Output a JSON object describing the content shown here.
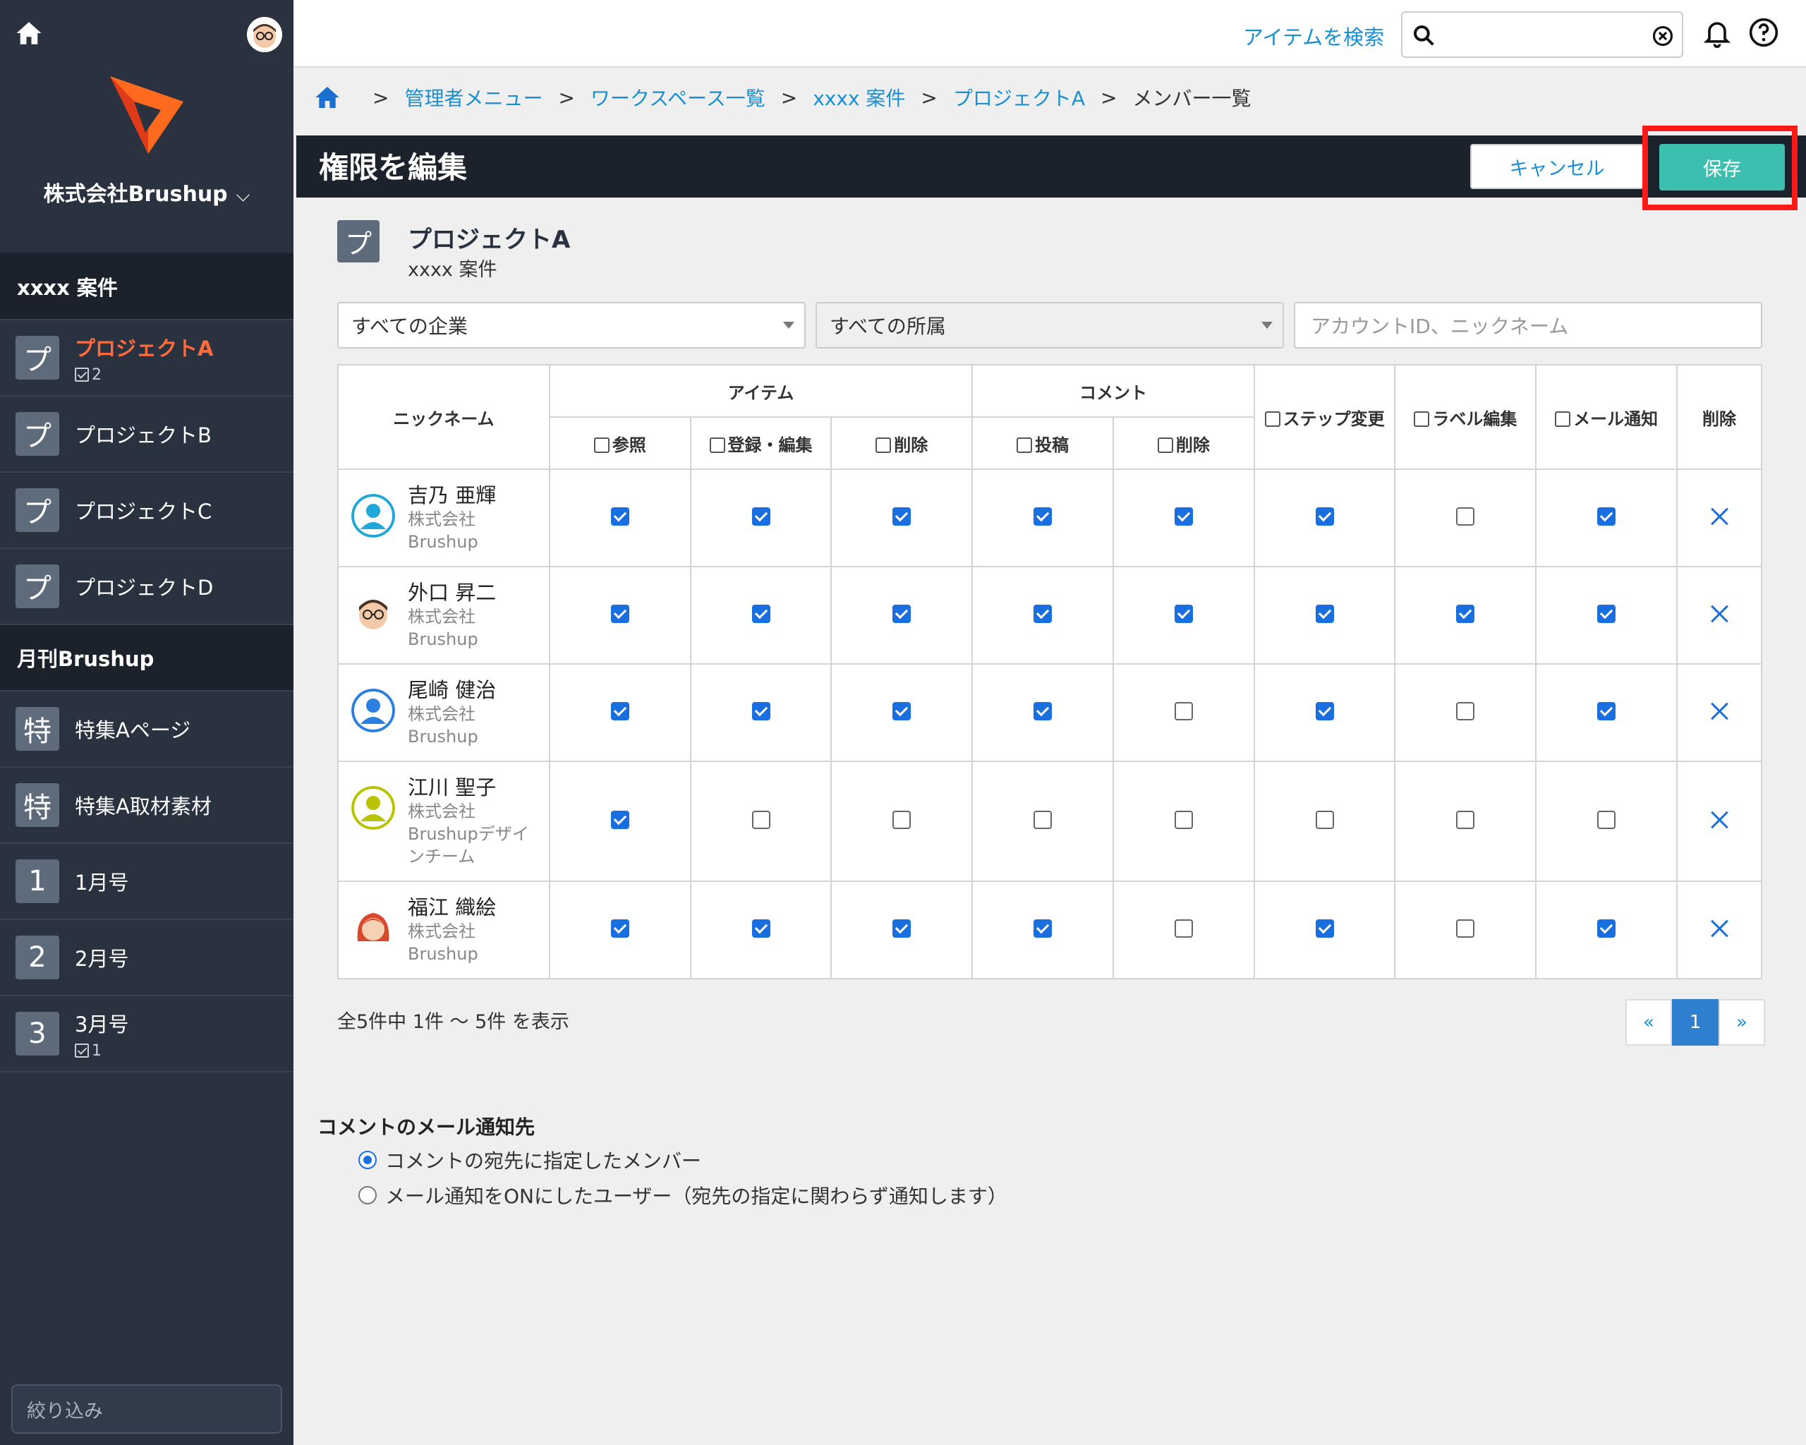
{
  "sidebar": {
    "company": "株式会社Brushup",
    "groups": [
      {
        "title": "xxxx 案件",
        "items": [
          {
            "badge": "プ",
            "label": "プロジェクトA",
            "count": "2",
            "active": true
          },
          {
            "badge": "プ",
            "label": "プロジェクトB"
          },
          {
            "badge": "プ",
            "label": "プロジェクトC"
          },
          {
            "badge": "プ",
            "label": "プロジェクトD"
          }
        ]
      },
      {
        "title": "月刊Brushup",
        "items": [
          {
            "badge": "特",
            "label": "特集Aページ"
          },
          {
            "badge": "特",
            "label": "特集A取材素材"
          },
          {
            "badge": "1",
            "label": "1月号"
          },
          {
            "badge": "2",
            "label": "2月号"
          },
          {
            "badge": "3",
            "label": "3月号",
            "count": "1"
          }
        ]
      }
    ],
    "filter_placeholder": "絞り込み"
  },
  "topbar": {
    "search_link": "アイテムを検索",
    "search_value": ""
  },
  "breadcrumb": {
    "items": [
      "管理者メニュー",
      "ワークスペース一覧",
      "xxxx 案件",
      "プロジェクトA"
    ],
    "current": "メンバー一覧"
  },
  "header": {
    "title": "権限を編集",
    "cancel_label": "キャンセル",
    "save_label": "保存"
  },
  "project": {
    "badge": "プ",
    "name": "プロジェクトA",
    "sub": "xxxx 案件"
  },
  "filters": {
    "company": "すべての企業",
    "affiliation": "すべての所属",
    "account_placeholder": "アカウントID、ニックネーム"
  },
  "table": {
    "col_nickname": "ニックネーム",
    "group_item": "アイテム",
    "group_comment": "コメント",
    "col_view": "参照",
    "col_register_edit": "登録・編集",
    "col_item_delete": "削除",
    "col_post": "投稿",
    "col_comment_delete": "削除",
    "col_step_change": "ステップ変更",
    "col_label_edit": "ラベル編集",
    "col_mail_notify": "メール通知",
    "col_delete": "削除",
    "rows": [
      {
        "name": "吉乃 亜輝",
        "org": [
          "株式会社",
          "Brushup"
        ],
        "avatar": "generic-cyan",
        "perms": [
          1,
          1,
          1,
          1,
          1,
          1,
          0,
          1
        ]
      },
      {
        "name": "外口 昇二",
        "org": [
          "株式会社",
          "Brushup"
        ],
        "avatar": "glasses-man",
        "perms": [
          1,
          1,
          1,
          1,
          1,
          1,
          1,
          1
        ]
      },
      {
        "name": "尾崎 健治",
        "org": [
          "株式会社",
          "Brushup"
        ],
        "avatar": "generic-blue",
        "perms": [
          1,
          1,
          1,
          1,
          0,
          1,
          0,
          1
        ]
      },
      {
        "name": "江川 聖子",
        "org": [
          "株式会社",
          "Brushupデザイ",
          "ンチーム"
        ],
        "avatar": "generic-lime",
        "perms": [
          1,
          0,
          0,
          0,
          0,
          0,
          0,
          0
        ]
      },
      {
        "name": "福江 織絵",
        "org": [
          "株式会社",
          "Brushup"
        ],
        "avatar": "red-hair-woman",
        "perms": [
          1,
          1,
          1,
          1,
          0,
          1,
          0,
          1
        ]
      }
    ]
  },
  "footer": {
    "count_text": "全5件中 1件 〜 5件 を表示",
    "pager": {
      "prev": "«",
      "current": "1",
      "next": "»"
    }
  },
  "notify": {
    "title": "コメントのメール通知先",
    "option1": "コメントの宛先に指定したメンバー",
    "option2": "メール通知をONにしたユーザー（宛先の指定に関わらず通知します）",
    "selected": 1
  },
  "colors": {
    "accent": "#1a8fd1",
    "save": "#3cbfae",
    "active_item": "#ff6b3d",
    "highlight_frame": "#ff1a1a"
  }
}
